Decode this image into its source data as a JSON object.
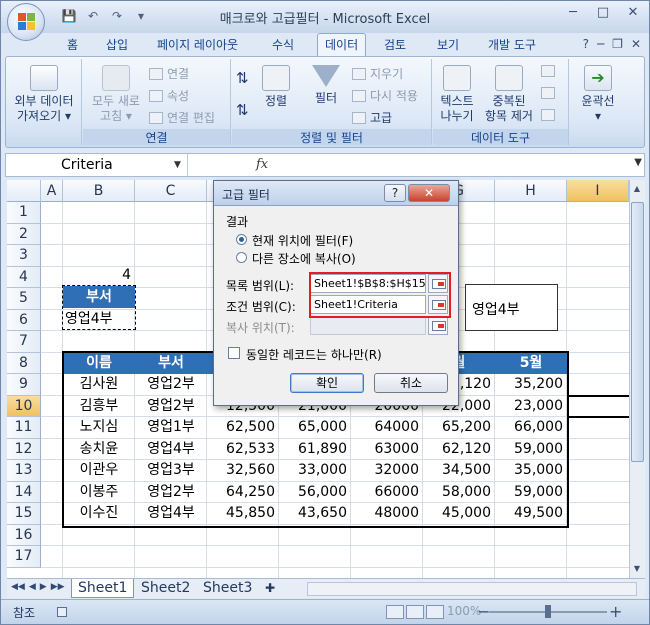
{
  "window": {
    "title": "매크로와 고급필터 - Microsoft Excel",
    "controls": {
      "minimize": "─",
      "maximize": "□",
      "close": "✕"
    }
  },
  "qat": {
    "save": "💾",
    "undo": "↶",
    "redo": "↷",
    "customize": "▾"
  },
  "ribbon_tabs": [
    "홈",
    "삽입",
    "페이지 레이아웃",
    "수식",
    "데이터",
    "검토",
    "보기",
    "개발 도구"
  ],
  "active_tab": "데이터",
  "tab_right": {
    "help": "?",
    "min": "─",
    "restore": "❐",
    "close": "✕"
  },
  "ribbon": {
    "ext_data": {
      "label1": "외부 데이터",
      "label2": "가져오기 ▾"
    },
    "connections": {
      "refresh1": "모두 새로",
      "refresh2": "고침 ▾",
      "connect": "연결",
      "props": "속성",
      "edit_links": "연결 편집",
      "group": "연결"
    },
    "sort_filter": {
      "sort": "정렬",
      "filter": "필터",
      "clear": "지우기",
      "reapply": "다시 적용",
      "advanced": "고급",
      "group": "정렬 및 필터"
    },
    "data_tools": {
      "text1": "텍스트",
      "text2": "나누기",
      "dup1": "중복된",
      "dup2": "항목 제거",
      "group": "데이터 도구"
    },
    "outline": {
      "label": "윤곽선",
      "arrow": "▾"
    }
  },
  "formula_bar": {
    "name_box": "Criteria",
    "fx": "fx",
    "value": ""
  },
  "columns": [
    "A",
    "B",
    "C",
    "D",
    "E",
    "F",
    "G",
    "H",
    "I"
  ],
  "selected_column": "I",
  "rows": [
    "1",
    "2",
    "3",
    "4",
    "5",
    "6",
    "7",
    "8",
    "9",
    "10",
    "11",
    "12",
    "13",
    "14",
    "15",
    "16",
    "17"
  ],
  "selected_row": "10",
  "cells": {
    "e4": "4",
    "b5": "부서",
    "b6": "영업4부",
    "g5": "영업4부"
  },
  "table": {
    "headers": [
      "이름",
      "부서",
      "",
      "",
      "",
      "월",
      "5월"
    ],
    "rows": [
      [
        "김사원",
        "영업2부",
        "",
        "",
        "",
        "5,120",
        "35,200"
      ],
      [
        "김흥부",
        "영업2부",
        "12,500",
        "21,000",
        "20000",
        "22,000",
        "23,000"
      ],
      [
        "노지심",
        "영업1부",
        "62,500",
        "65,000",
        "64000",
        "65,200",
        "66,000"
      ],
      [
        "송치윤",
        "영업4부",
        "62,533",
        "61,890",
        "63000",
        "62,120",
        "59,000"
      ],
      [
        "이관우",
        "영업3부",
        "32,560",
        "33,000",
        "32000",
        "34,500",
        "35,000"
      ],
      [
        "이봉주",
        "영업2부",
        "64,250",
        "56,000",
        "66000",
        "58,000",
        "59,000"
      ],
      [
        "이수진",
        "영업4부",
        "45,850",
        "43,650",
        "48000",
        "45,000",
        "49,500"
      ]
    ]
  },
  "sheets": [
    "Sheet1",
    "Sheet2",
    "Sheet3"
  ],
  "active_sheet": "Sheet1",
  "status": {
    "mode": "참조",
    "zoom": "100%",
    "minus": "−",
    "plus": "+"
  },
  "dialog": {
    "title": "고급 필터",
    "help": "?",
    "close": "✕",
    "result_label": "결과",
    "opt_inplace": "현재 위치에 필터(F)",
    "opt_copy": "다른 장소에 복사(O)",
    "list_range_label": "목록 범위(L):",
    "list_range_value": "Sheet1!$B$8:$H$15",
    "criteria_label": "조건 범위(C):",
    "criteria_value": "Sheet1!Criteria",
    "copy_to_label": "복사 위치(T):",
    "copy_to_value": "",
    "unique_label": "동일한 레코드는 하나만(R)",
    "ok": "확인",
    "cancel": "취소"
  },
  "colors": {
    "header_blue": "#2f6fb5",
    "highlight_red": "#e02020",
    "selected_orange": "#f0c160"
  }
}
